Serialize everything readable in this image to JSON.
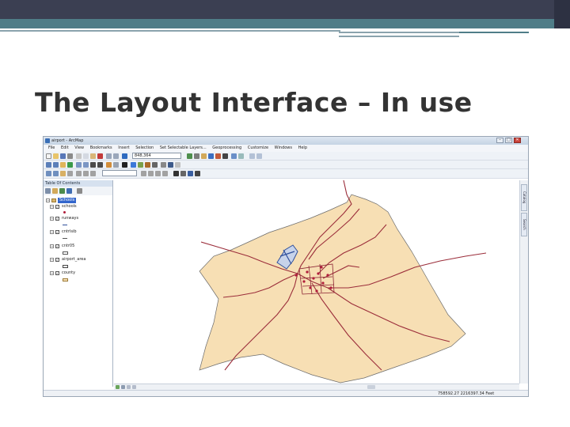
{
  "slide": {
    "title": "The Layout Interface – In use"
  },
  "window": {
    "title": "airport - ArcMap",
    "title_rest": "— (document path)",
    "minimize": "–",
    "maximize": "□",
    "close": "✕"
  },
  "menu": {
    "items": [
      "File",
      "Edit",
      "View",
      "Bookmarks",
      "Insert",
      "Selection",
      "Set Selectable Layers...",
      "Geoprocessing",
      "Customize",
      "Windows",
      "Help"
    ]
  },
  "toolbar": {
    "scale_value": "848,364",
    "zoom_value": ""
  },
  "toc": {
    "header": "Table Of Contents",
    "frame": "Schools",
    "layers": [
      {
        "name": "schools",
        "checked": true
      },
      {
        "name": "runways",
        "checked": true
      },
      {
        "name": "cntrlsib",
        "checked": true
      },
      {
        "name": "cntr05",
        "checked": true
      },
      {
        "name": "airport_area",
        "checked": true
      },
      {
        "name": "county",
        "checked": true
      }
    ]
  },
  "side_tabs": [
    "Catalog",
    "Search"
  ],
  "status": {
    "coordinates": "758592.27  2216397.34 Feet"
  },
  "colors": {
    "slide_bar_dark": "#3b3f52",
    "slide_bar_teal": "#4f7d88",
    "county_fill": "#f7dfb4",
    "roads": "#9b2d3a",
    "schools_points": "#b01c3a",
    "runways": "#2f4f9a"
  }
}
